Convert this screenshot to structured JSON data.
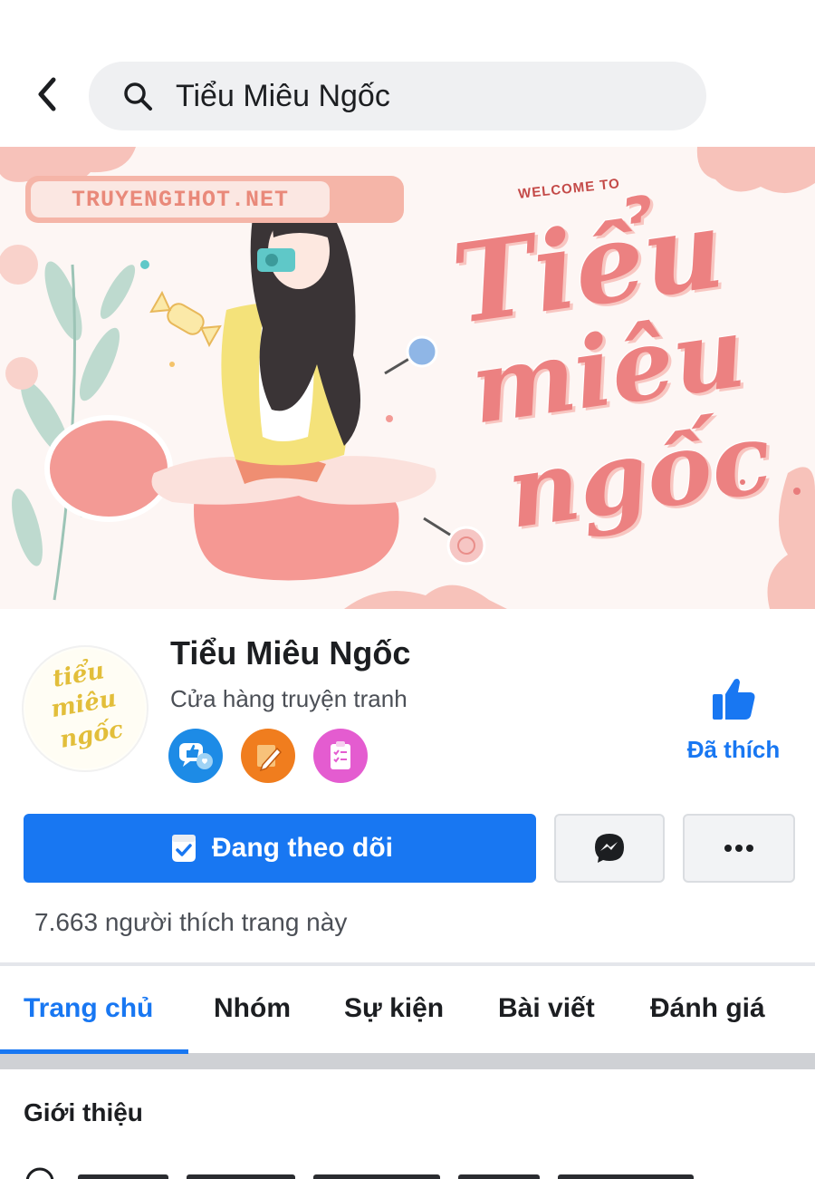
{
  "search": {
    "query": "Tiểu Miêu Ngốc"
  },
  "cover": {
    "site_label": "TRUYENGIHOT.NET",
    "welcome_text": "WELCOME TO",
    "script_line1": "Tiểu",
    "script_line2": "miêu",
    "script_line3": "ngốc"
  },
  "profile": {
    "name": "Tiểu Miêu Ngốc",
    "category": "Cửa hàng truyện tranh",
    "avatar_line1": "tiểu",
    "avatar_line2": "miêu",
    "avatar_line3": "ngốc",
    "badges": [
      "like-message-badge",
      "pencil-badge",
      "clipboard-badge"
    ],
    "like_label": "Đã thích"
  },
  "actions": {
    "follow_label": "Đang theo dõi",
    "messenger_icon": "messenger-icon",
    "more_icon": "more-icon"
  },
  "stats": {
    "likes_text": "7.663 người thích trang này"
  },
  "tabs": [
    {
      "label": "Trang chủ",
      "active": true
    },
    {
      "label": "Nhóm",
      "active": false
    },
    {
      "label": "Sự kiện",
      "active": false
    },
    {
      "label": "Bài viết",
      "active": false
    },
    {
      "label": "Đánh giá",
      "active": false
    }
  ],
  "about": {
    "title": "Giới thiệu"
  },
  "colors": {
    "brand_blue": "#1877f2",
    "cover_pink": "#ec8181"
  }
}
